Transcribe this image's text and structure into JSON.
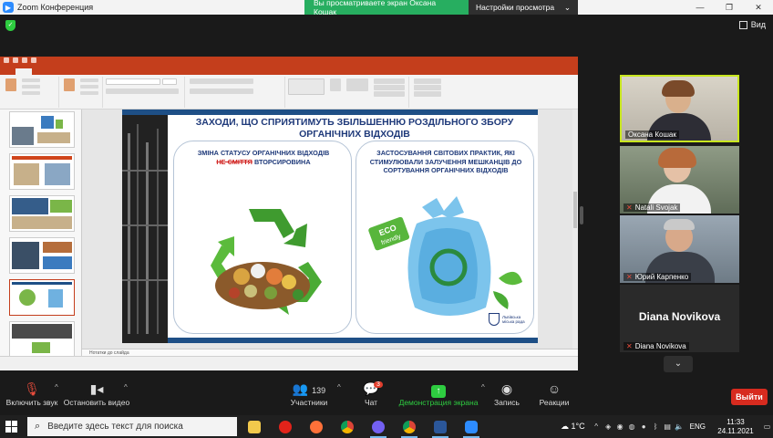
{
  "window": {
    "title": "Zoom Конференция",
    "share_message": "Вы просматриваете экран Оксана Кошак",
    "view_options": "Настройки просмотра",
    "view_label": "Вид"
  },
  "colors": {
    "zoom_blue": "#2d8cff",
    "ppt_red": "#c43e1c",
    "share_green": "#27ae60",
    "active_speaker": "#c8e61f",
    "exit_red": "#d72b1f",
    "slide_title_blue": "#1f3a7a"
  },
  "slide": {
    "title_line1": "ЗАХОДИ, ЩО СПРИЯТИМУТЬ ЗБІЛЬШЕННЮ РОЗДІЛЬНОГО ЗБОРУ",
    "title_line2": "ОРГАНІЧНИХ ВІДХОДІВ",
    "left_text_1": "ЗМІНА СТАТУСУ ОРГАНІЧНИХ ВІДХОДІВ",
    "left_strike": "НЕ СМІТТЯ",
    "left_text_2": " ВТОРСИРОВИНА",
    "right_text": "ЗАСТОСУВАННЯ СВІТОВИХ ПРАКТИК, ЯКІ СТИМУЛЮВАЛИ ЗАЛУЧЕННЯ МЕШКАНЦІВ ДО СОРТУВАННЯ ОРГАНІЧНИХ ВІДХОДІВ",
    "eco_tag_1": "ECO",
    "eco_tag_2": "friendly",
    "logo_text": "Львівська міська рада"
  },
  "ppt": {
    "notes_placeholder": "Нотатки до слайда",
    "thumb_numbers": [
      "5",
      "6",
      "7",
      "8",
      "9",
      "10"
    ]
  },
  "participants": [
    {
      "name": "Оксана Кошак",
      "muted": false,
      "active": true
    },
    {
      "name": "Natali Svojak",
      "muted": true,
      "active": false
    },
    {
      "name": "Юрий Карпенко",
      "muted": true,
      "active": false
    },
    {
      "name": "Diana Novikova",
      "muted": true,
      "active": false,
      "avatar_text": "Diana Novikova"
    }
  ],
  "toolbar": {
    "audio": "Включить звук",
    "video": "Остановить видео",
    "participants": "Участники",
    "participants_count": "139",
    "chat": "Чат",
    "chat_badge": "3",
    "share": "Демонстрация экрана",
    "record": "Запись",
    "reactions": "Реакции",
    "exit": "Выйти"
  },
  "taskbar": {
    "search_placeholder": "Введите здесь текст для поиска",
    "weather": "1°C",
    "language": "ENG",
    "time": "11:33",
    "date": "24.11.2021"
  }
}
